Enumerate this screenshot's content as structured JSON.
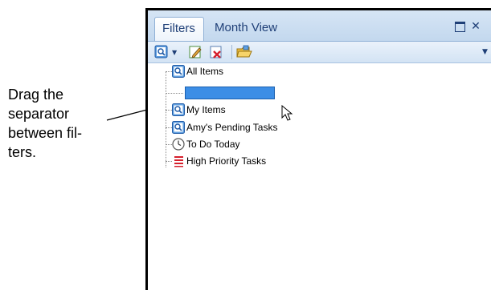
{
  "callout": {
    "lines": [
      "Drag the",
      "separator",
      "between fil-",
      "ters."
    ]
  },
  "tabs": [
    {
      "label": "Filters",
      "active": true
    },
    {
      "label": "Month View",
      "active": false
    }
  ],
  "window_controls": {
    "maximize_icon": "maximize-icon",
    "close_label": "✕"
  },
  "toolbar": {
    "icons": [
      "search-filter-icon",
      "dropdown-arrow-icon",
      "edit-icon",
      "delete-icon",
      "folder-icon"
    ]
  },
  "tree": {
    "items": [
      {
        "label": "All Items",
        "icon": "search-filter-icon"
      },
      {
        "label": "",
        "icon": "drop-separator"
      },
      {
        "label": "My Items",
        "icon": "search-filter-icon"
      },
      {
        "label": "Amy's Pending Tasks",
        "icon": "search-filter-icon"
      },
      {
        "label": "To Do Today",
        "icon": "clock-icon"
      },
      {
        "label": "High Priority Tasks",
        "icon": "priority-list-icon"
      }
    ]
  },
  "colors": {
    "tab_text": "#1f3f77",
    "separator_highlight": "#3c8ee6",
    "priority_red": "#d61f2c"
  }
}
